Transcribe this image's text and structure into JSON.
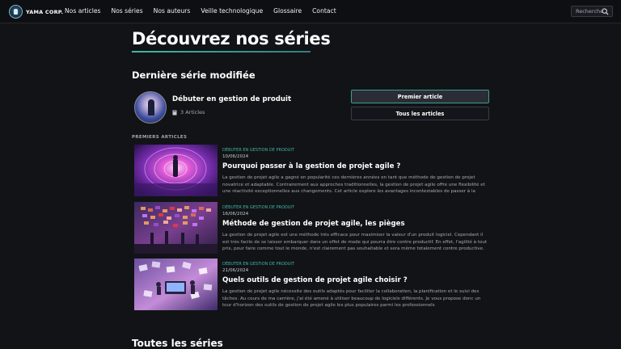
{
  "nav": {
    "logo_text": "YAMA CORP.",
    "links": [
      "Nos articles",
      "Nos séries",
      "Nos auteurs",
      "Veille technologique",
      "Glossaire",
      "Contact"
    ],
    "search_placeholder": "Recherche",
    "search_icon": "search-icon"
  },
  "page": {
    "title": "Découvrez nos séries",
    "accent_color": "#3fb6a8"
  },
  "last_series": {
    "section_title": "Dernière série modifiée",
    "name": "Débuter en gestion de produit",
    "articles_count": "3 Articles",
    "count_icon": "book-icon",
    "first_article_button": "Premier article",
    "all_articles_button": "Tous les articles"
  },
  "first_articles": {
    "label": "PREMIERS ARTICLES",
    "items": [
      {
        "series": "DÉBUTER EN GESTION DE PRODUIT",
        "date": "10/06/2024",
        "title": "Pourquoi passer à la gestion de projet agile ?",
        "excerpt": "La gestion de projet agile a gagné en popularité ces dernières années en tant que méthode de gestion de projet novatrice et adaptable. Contrairement aux approches traditionnelles, la gestion de projet agile offre une flexibilité et une réactivité exceptionnelles aux changements. Cet article explore les avantages incontestables de passer à la gestion de projet agile,..."
      },
      {
        "series": "DÉBUTER EN GESTION DE PRODUIT",
        "date": "16/06/2024",
        "title": "Méthode de gestion de projet agile, les pièges",
        "excerpt": "La gestion de projet agile est une méthode très efficace pour maximiser la valeur d'un produit logiciel. Cependant il est très facile de se laisser embarquer dans un effet de mode qui pourra être contre productif. En effet, l'agilité à tout prix, pour faire comme tout le monde, n'est clairement pas souhaitable et sera même totalement contre productive. Voici quelques pièges ..."
      },
      {
        "series": "DÉBUTER EN GESTION DE PRODUIT",
        "date": "21/06/2024",
        "title": "Quels outils de gestion de projet agile choisir ?",
        "excerpt": "La gestion de projet agile nécessite des outils adaptés pour faciliter la collaboration, la planification et le suivi des tâches. Au cours de ma carrière, j'ai été amené à utiliser beaucoup de logiciels différents. Je vous propose donc un tour d'horizon des outils de gestion de projet agile les plus populaires parmi les professionnels"
      }
    ]
  },
  "all_series": {
    "title": "Toutes les séries"
  }
}
